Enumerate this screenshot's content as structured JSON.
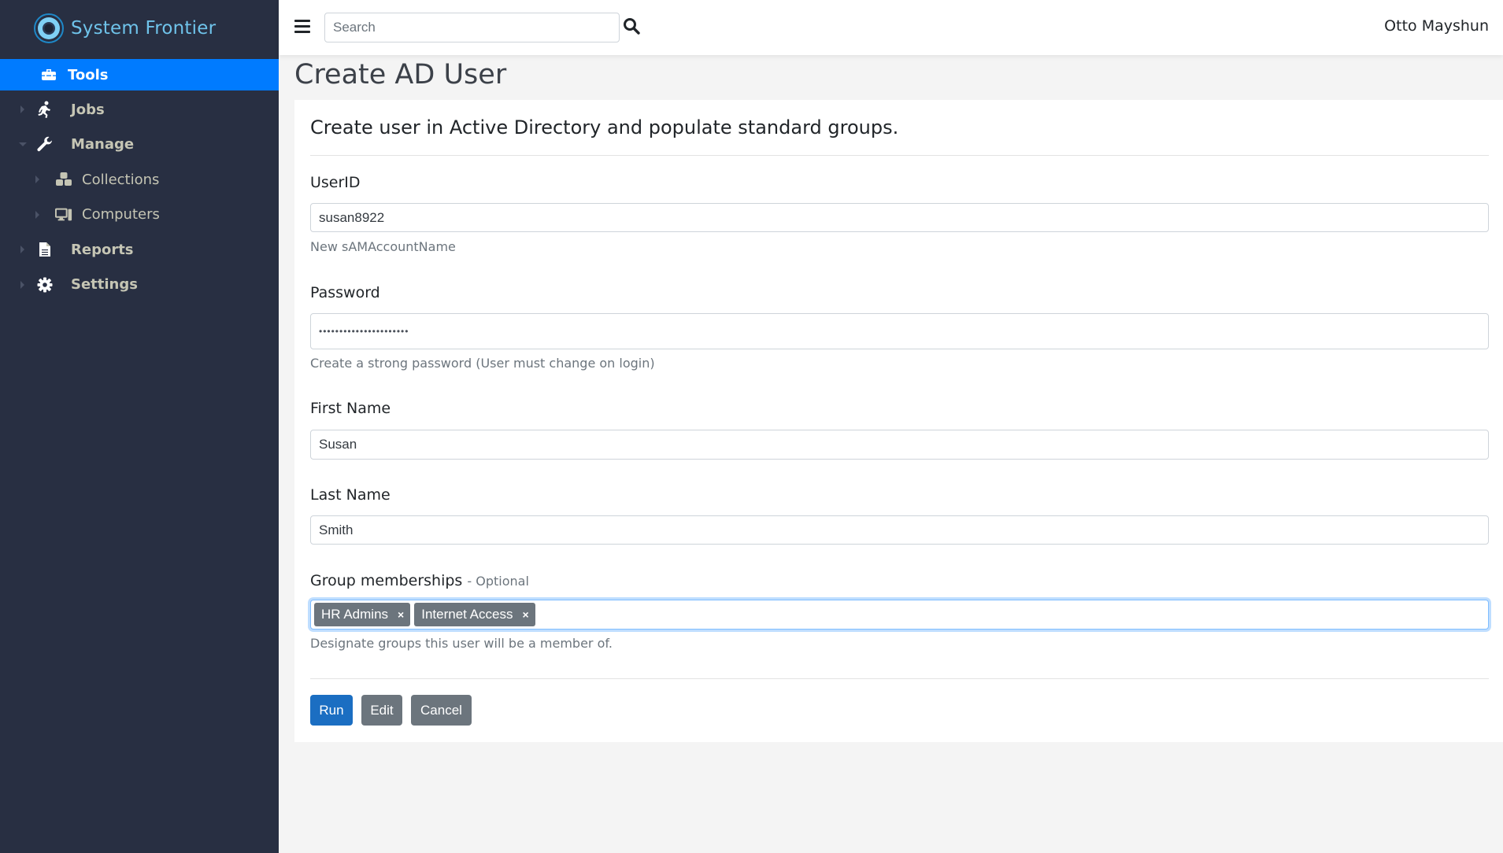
{
  "brand": {
    "name": "System Frontier",
    "accent": "#6fc3ea"
  },
  "sidebar": {
    "items": [
      {
        "label": "Tools",
        "icon": "toolbox-icon",
        "active": true
      },
      {
        "label": "Jobs",
        "icon": "running-icon",
        "expanded": false
      },
      {
        "label": "Manage",
        "icon": "wrench-icon",
        "expanded": true
      },
      {
        "label": "Collections",
        "icon": "cubes-icon",
        "sub": true
      },
      {
        "label": "Computers",
        "icon": "desktop-icon",
        "sub": true
      },
      {
        "label": "Reports",
        "icon": "file-icon",
        "expanded": false
      },
      {
        "label": "Settings",
        "icon": "gear-icon",
        "expanded": false
      }
    ]
  },
  "topbar": {
    "menu_icon": "hamburger-icon",
    "search": {
      "placeholder": "Search",
      "value": ""
    },
    "search_icon": "search-icon",
    "user": "Otto Mayshun"
  },
  "page": {
    "title": "Create AD User",
    "heading": "Create user in Active Directory and populate standard groups.",
    "fields": {
      "userid": {
        "label": "UserID",
        "value": "susan8922",
        "help": "New sAMAccountName"
      },
      "password": {
        "label": "Password",
        "value": "••••••••••••••••••••••",
        "help": "Create a strong password (User must change on login)"
      },
      "first_name": {
        "label": "First Name",
        "value": "Susan"
      },
      "last_name": {
        "label": "Last Name",
        "value": "Smith"
      },
      "groups": {
        "label": "Group memberships",
        "optional": "- Optional",
        "tags": [
          "HR Admins",
          "Internet Access"
        ],
        "remove_glyph": "×",
        "help": "Designate groups this user will be a member of."
      }
    },
    "buttons": {
      "run": "Run",
      "edit": "Edit",
      "cancel": "Cancel"
    }
  },
  "colors": {
    "primary": "#1b6ec2",
    "secondary": "#6c757d",
    "sidebar_bg": "#282f42",
    "active_nav": "#007bff"
  }
}
